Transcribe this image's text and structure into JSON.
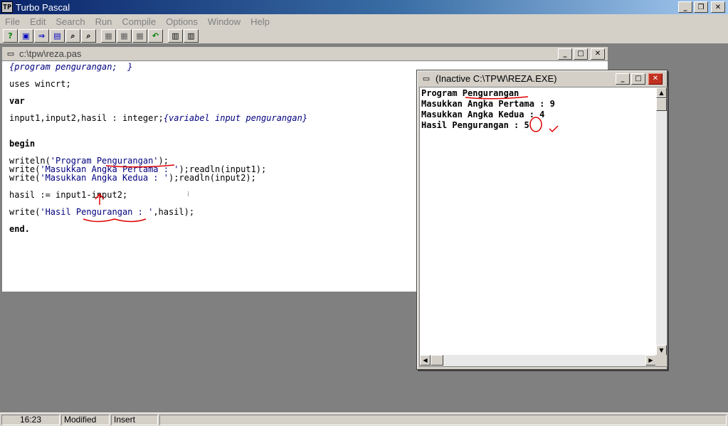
{
  "app": {
    "title": "Turbo Pascal",
    "icon": "turbo-pascal-app-icon"
  },
  "menu": [
    "File",
    "Edit",
    "Search",
    "Run",
    "Compile",
    "Options",
    "Window",
    "Help"
  ],
  "toolbar": {
    "buttons": [
      "help-icon",
      "save-icon",
      "open-icon",
      "save-all-icon",
      "find-icon",
      "find-next-icon",
      "compile-icon",
      "make-icon",
      "build-icon",
      "undo-icon",
      "run-icon",
      "step-icon"
    ]
  },
  "editor": {
    "title": "c:\\tpw\\reza.pas",
    "lines": {
      "l1": "{program pengurangan;  }",
      "l2": "uses wincrt;",
      "l3": "var",
      "l4a": "input1,input2,hasil : integer;",
      "l4b": "{variabel input pengurangan}",
      "l5": "begin",
      "l6a": "writeln(",
      "l6b": "'Program Pengurangan'",
      "l6c": ");",
      "l7a": "write(",
      "l7b": "'Masukkan Angka Pertama : '",
      "l7c": ");readln(input1);",
      "l8a": "write(",
      "l8b": "'Masukkan Angka Kedua : '",
      "l8c": ");readln(input2);",
      "l9": "hasil := input1-input2;",
      "l10a": "write(",
      "l10b": "'Hasil Pengurangan : '",
      "l10c": ",hasil);",
      "l11": "end."
    }
  },
  "output": {
    "title": "(Inactive C:\\TPW\\REZA.EXE)",
    "lines": [
      "Program Pengurangan",
      "Masukkan Angka Pertama : 9",
      "Masukkan Angka Kedua : 4",
      "Hasil Pengurangan : 5"
    ]
  },
  "status": {
    "position": "16:23",
    "modified": "Modified",
    "insert": "Insert"
  },
  "colors": {
    "annotation": "#e00000",
    "string": "#000080",
    "titlebar": "#0a246a"
  }
}
